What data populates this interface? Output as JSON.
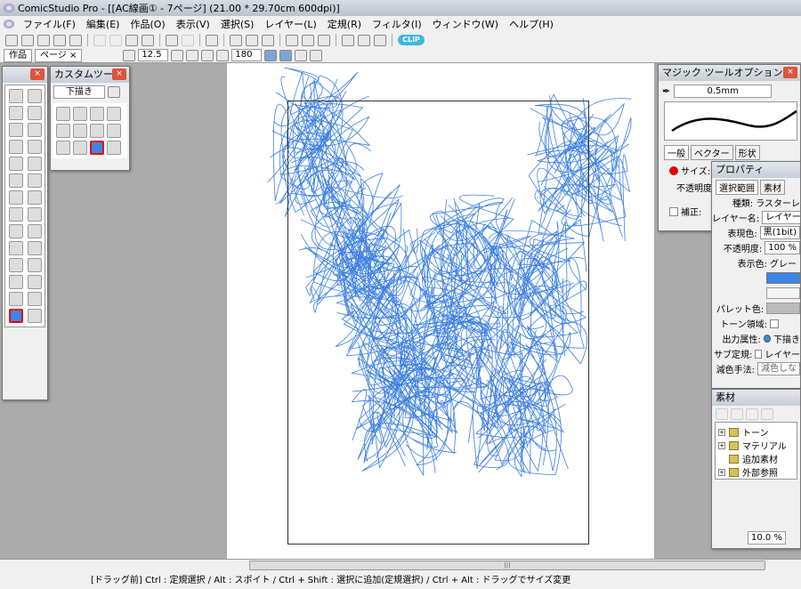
{
  "window": {
    "title": "ComicStudio Pro - [[AC線画① - 7ページ] (21.00 * 29.70cm 600dpi)]"
  },
  "menu": [
    "ファイル(F)",
    "編集(E)",
    "作品(O)",
    "表示(V)",
    "選択(S)",
    "レイヤー(L)",
    "定規(R)",
    "フィルタ(I)",
    "ウィンドウ(W)",
    "ヘルプ(H)"
  ],
  "toolbar": {
    "clip_label": "CLIP"
  },
  "tabs": [
    {
      "label": "作品"
    },
    {
      "label": "ページ ×"
    }
  ],
  "viewbar": {
    "zoom": "12.5",
    "rotation": "180"
  },
  "custom_tool": {
    "title": "カスタムツール",
    "preset": "下描き"
  },
  "magic_options": {
    "title": "マジック ツールオプション",
    "size": "0.5mm",
    "tabs": [
      "一般",
      "ベクター",
      "形状"
    ],
    "size_label": "サイズ:",
    "opacity_label": "不透明度",
    "correction_label": "補正:"
  },
  "properties": {
    "title": "プロパティ",
    "tabs": [
      "選択範囲",
      "素材"
    ],
    "rows": [
      {
        "label": "種類:",
        "value": "ラスターレ"
      },
      {
        "label": "レイヤー名:",
        "value": "レイヤー"
      },
      {
        "label": "表現色:",
        "value": "黒(1bit)"
      },
      {
        "label": "不透明度:",
        "value": "100 %"
      },
      {
        "label": "表示色:",
        "value": "グレー"
      }
    ],
    "palette_label": "パレット色:",
    "tone_label": "トーン領域:",
    "output_label": "出力属性:",
    "output_value": "下描き",
    "sub_label": "サブ定規:",
    "sub_value": "レイヤー",
    "reduce_label": "減色手法:",
    "reduce_value": "減色しな",
    "display_color": "#3b86e6"
  },
  "materials": {
    "title": "素材",
    "items": [
      "トーン",
      "マテリアル",
      "追加素材",
      "外部参照"
    ],
    "zoom": "10.0 %"
  },
  "status": "[ドラッグ前] Ctrl : 定規選択 / Alt : スポイト / Ctrl + Shift : 選択に追加(定規選択) / Ctrl + Alt : ドラッグでサイズ変更",
  "colors": {
    "sketch": "#3d7fe0",
    "close": "#d9553f"
  }
}
